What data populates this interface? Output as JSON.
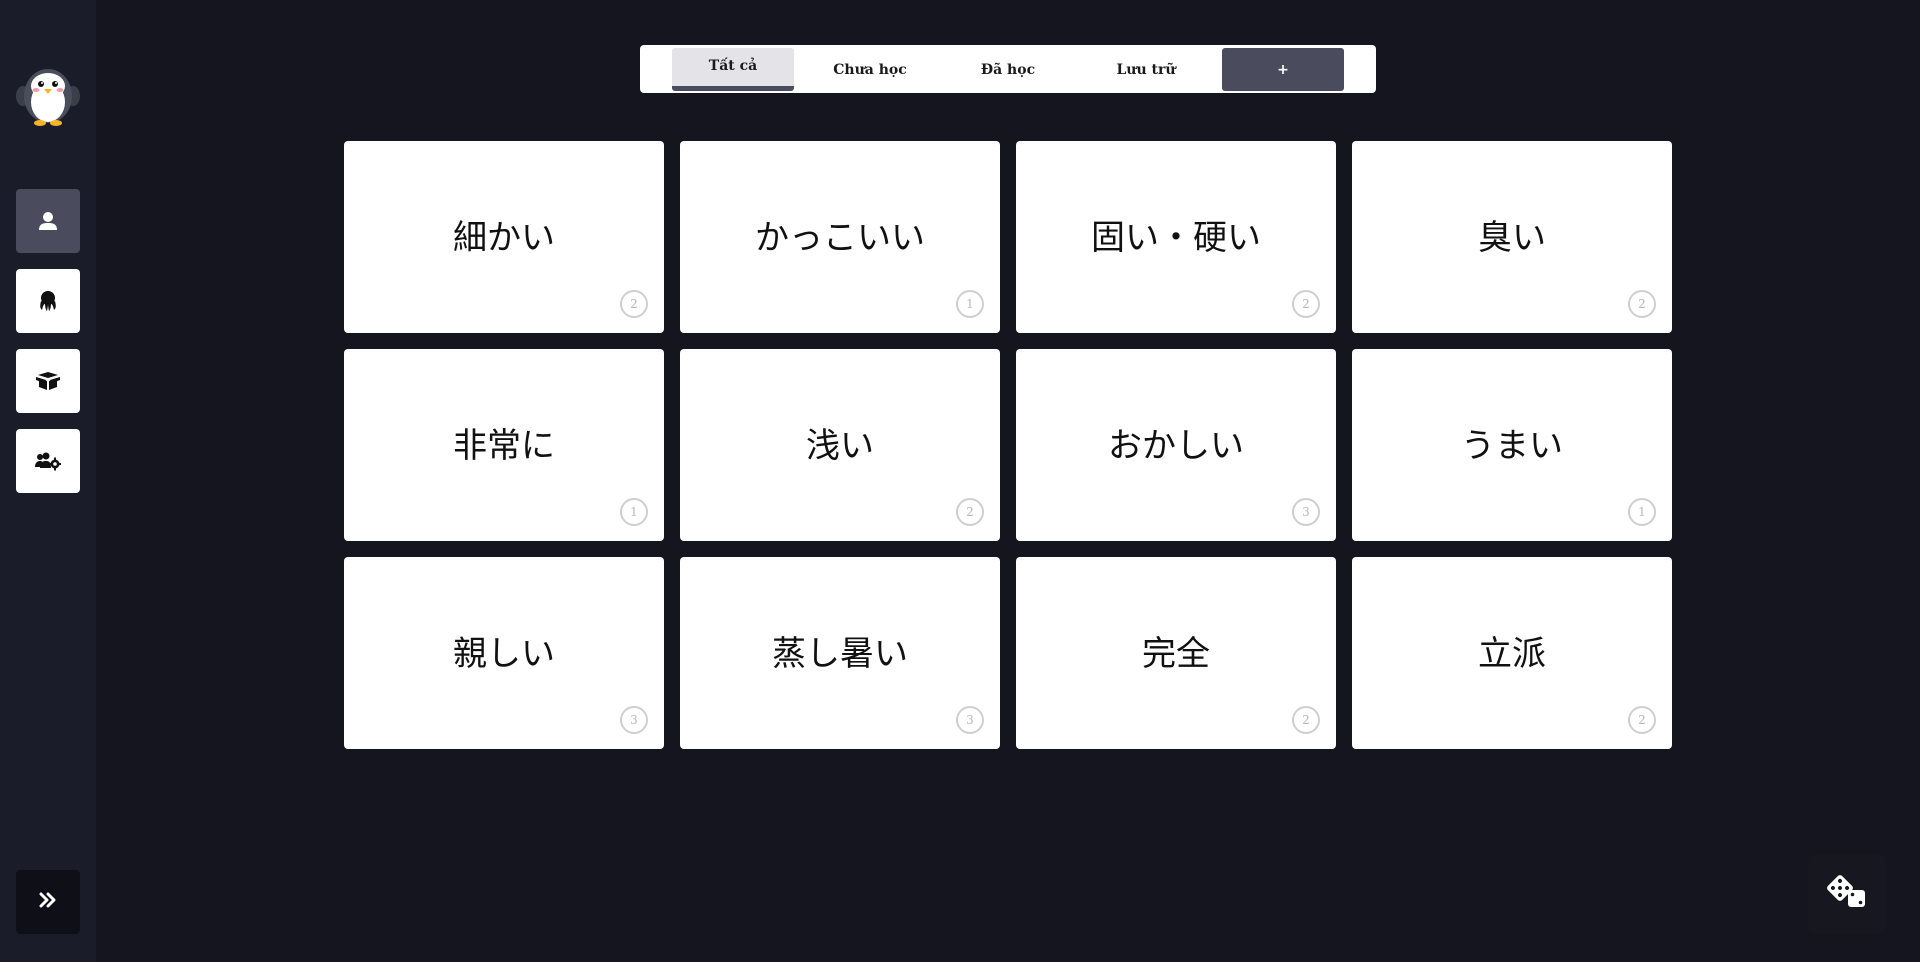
{
  "tabs": [
    {
      "label": "Tất cả",
      "active": true
    },
    {
      "label": "Chưa học",
      "active": false
    },
    {
      "label": "Đã học",
      "active": false
    },
    {
      "label": "Lưu trữ",
      "active": false
    }
  ],
  "add_tab_label": "+",
  "cards": [
    {
      "word": "細かい",
      "count": "2"
    },
    {
      "word": "かっこいい",
      "count": "1"
    },
    {
      "word": "固い・硬い",
      "count": "2"
    },
    {
      "word": "臭い",
      "count": "2"
    },
    {
      "word": "非常に",
      "count": "1"
    },
    {
      "word": "浅い",
      "count": "2"
    },
    {
      "word": "おかしい",
      "count": "3"
    },
    {
      "word": "うまい",
      "count": "1"
    },
    {
      "word": "親しい",
      "count": "3"
    },
    {
      "word": "蒸し暑い",
      "count": "3"
    },
    {
      "word": "完全",
      "count": "2"
    },
    {
      "word": "立派",
      "count": "2"
    }
  ],
  "sidebar": {
    "items": [
      {
        "icon": "user-icon",
        "active": true
      },
      {
        "icon": "octopus-icon",
        "active": false
      },
      {
        "icon": "box-icon",
        "active": false
      },
      {
        "icon": "users-gear-icon",
        "active": false
      }
    ],
    "logo_icon": "penguin-logo",
    "expand_icon": "double-chevron-right-icon"
  },
  "dice_icon": "dice-icon",
  "colors": {
    "background": "#14151f",
    "sidebar": "#1b1c29",
    "accent": "#4a4b5d",
    "card": "#ffffff"
  }
}
